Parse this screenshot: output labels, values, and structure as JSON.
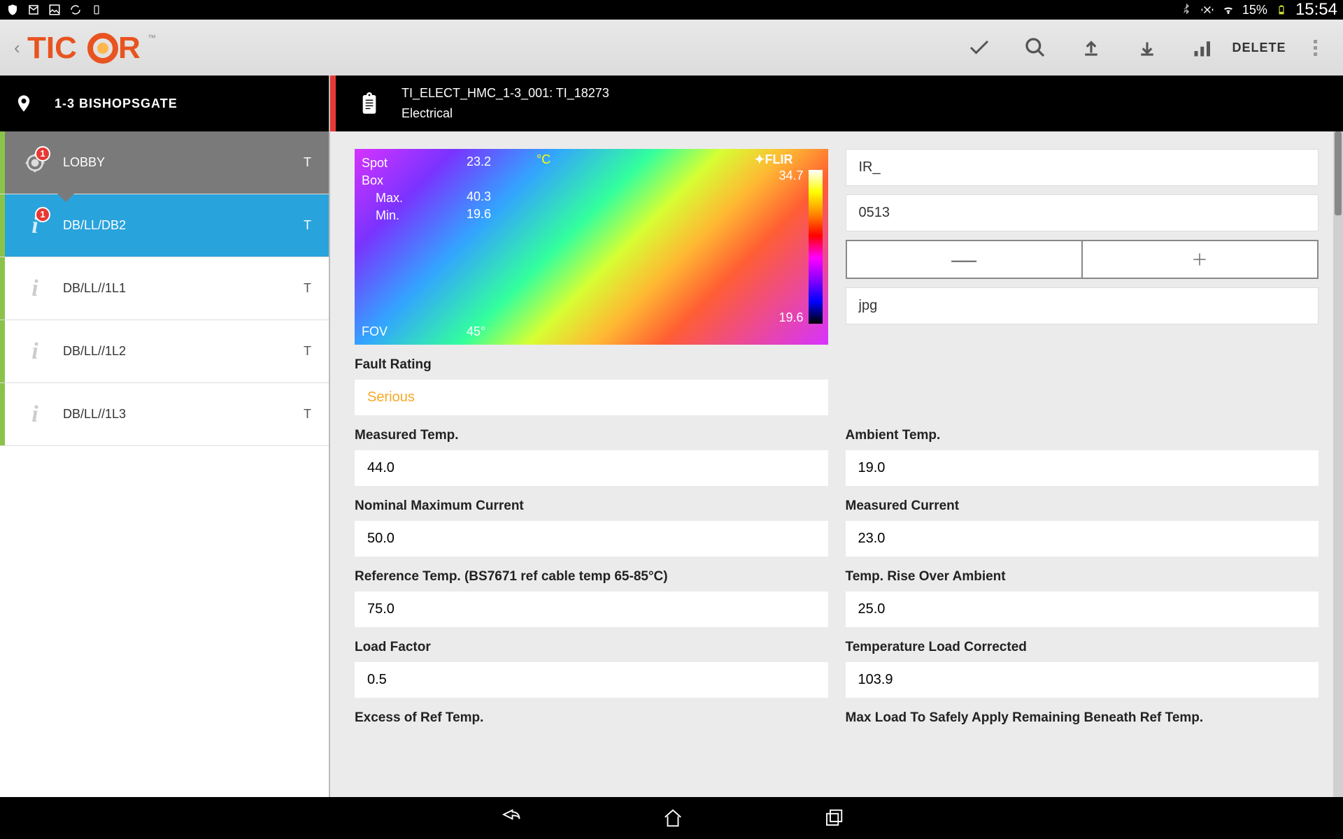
{
  "status": {
    "battery": "15%",
    "time": "15:54"
  },
  "header": {
    "delete": "DELETE"
  },
  "location": {
    "name": "1-3 BISHOPSGATE"
  },
  "sidebar": {
    "items": [
      {
        "label": "LOBBY",
        "t": "T",
        "badge": "1"
      },
      {
        "label": "DB/LL/DB2",
        "t": "T",
        "badge": "1"
      },
      {
        "label": "DB/LL//1L1",
        "t": "T"
      },
      {
        "label": "DB/LL//1L2",
        "t": "T"
      },
      {
        "label": "DB/LL//1L3",
        "t": "T"
      }
    ]
  },
  "contentHeader": {
    "title": "TI_ELECT_HMC_1-3_001: TI_18273",
    "subtitle": "Electrical"
  },
  "thermal": {
    "spot": "Spot",
    "box": "Box",
    "maxLabel": "Max.",
    "minLabel": "Min.",
    "spotVal": "23.2",
    "maxVal": "40.3",
    "minVal": "19.6",
    "degC": "°C",
    "flir": "✦FLIR",
    "fov": "FOV",
    "fovVal": "45°",
    "gradMax": "34.7",
    "gradMin": "19.6"
  },
  "inputs": {
    "prefix": "IR_",
    "number": "0513",
    "ext": "jpg",
    "minus": "—",
    "plus": "+"
  },
  "fields": {
    "faultRating": {
      "label": "Fault Rating",
      "value": "Serious"
    },
    "measuredTemp": {
      "label": "Measured Temp.",
      "value": "44.0"
    },
    "ambientTemp": {
      "label": "Ambient Temp.",
      "value": "19.0"
    },
    "nominalMax": {
      "label": "Nominal Maximum Current",
      "value": "50.0"
    },
    "measuredCurrent": {
      "label": "Measured Current",
      "value": "23.0"
    },
    "refTemp": {
      "label": "Reference Temp. (BS7671 ref cable temp 65-85°C)",
      "value": "75.0"
    },
    "tempRise": {
      "label": "Temp. Rise Over Ambient",
      "value": "25.0"
    },
    "loadFactor": {
      "label": "Load Factor",
      "value": "0.5"
    },
    "tempLoadCorrected": {
      "label": "Temperature Load Corrected",
      "value": "103.9"
    },
    "excessRef": {
      "label": "Excess of Ref Temp."
    },
    "maxLoadSafe": {
      "label": "Max Load To Safely Apply Remaining Beneath Ref Temp."
    }
  }
}
